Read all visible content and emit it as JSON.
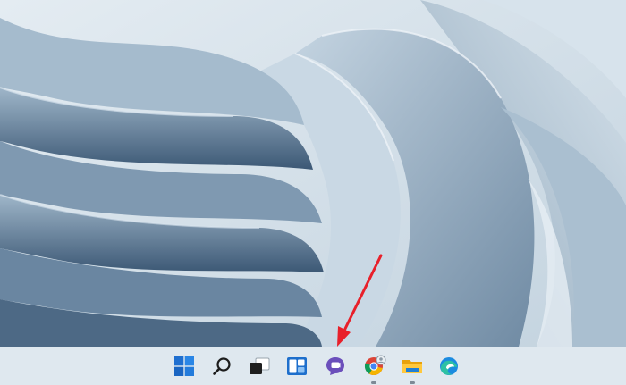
{
  "desktop": {
    "wallpaper": "windows-11-bloom-wallpaper",
    "colors": {
      "sky": "#dfe8ef",
      "light": "#b8cad8",
      "mid": "#8ea6bb",
      "dark": "#4e6a85",
      "deep": "#2c4560"
    }
  },
  "taskbar": {
    "background": "#dfe8ef",
    "items": [
      {
        "name": "start-button",
        "icon": "windows-logo-icon",
        "running": false
      },
      {
        "name": "search-button",
        "icon": "search-icon",
        "running": false
      },
      {
        "name": "task-view-button",
        "icon": "task-view-icon",
        "running": false
      },
      {
        "name": "widgets-button",
        "icon": "widgets-icon",
        "running": false
      },
      {
        "name": "chat-button",
        "icon": "chat-icon",
        "running": false
      },
      {
        "name": "chrome-button",
        "icon": "chrome-icon",
        "running": true
      },
      {
        "name": "file-explorer-button",
        "icon": "folder-icon",
        "running": true
      },
      {
        "name": "edge-button",
        "icon": "edge-icon",
        "running": false
      }
    ]
  },
  "annotation": {
    "arrow_color": "#e8202a",
    "points_to": "chat-button"
  }
}
